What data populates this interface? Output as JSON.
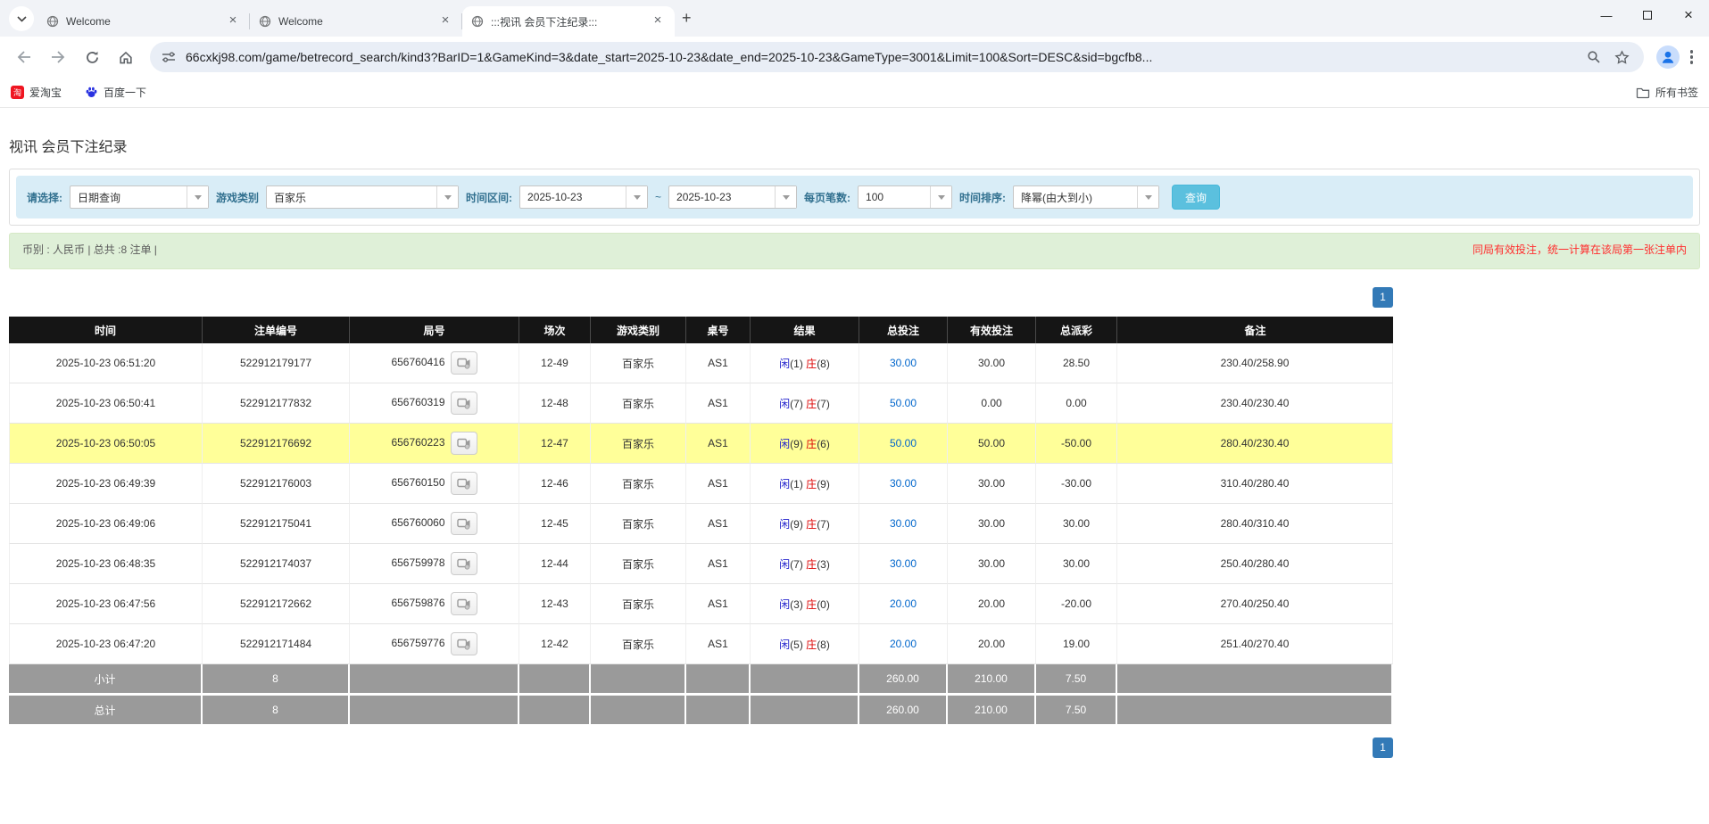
{
  "browser": {
    "tabs": [
      {
        "title": "Welcome"
      },
      {
        "title": "Welcome"
      },
      {
        "title": ":::视讯 会员下注纪录:::"
      }
    ],
    "url": "66cxkj98.com/game/betrecord_search/kind3?BarID=1&GameKind=3&date_start=2025-10-23&date_end=2025-10-23&GameType=3001&Limit=100&Sort=DESC&sid=bgcfb8...",
    "bookmarks": {
      "items": [
        {
          "label": "爱淘宝"
        },
        {
          "label": "百度一下"
        }
      ],
      "all_label": "所有书签"
    }
  },
  "page": {
    "title": "视讯 会员下注纪录",
    "filters": {
      "select_label": "请选择:",
      "select_value": "日期查询",
      "game_label": "游戏类别",
      "game_value": "百家乐",
      "range_label": "时间区间:",
      "date_start": "2025-10-23",
      "range_sep": "~",
      "date_end": "2025-10-23",
      "per_page_label": "每页笔数:",
      "per_page_value": "100",
      "sort_label": "时间排序:",
      "sort_value": "降幂(由大到小)",
      "search_button": "查询"
    },
    "summary": {
      "currency_info": "币别 : 人民币 | 总共 :8 注单 |",
      "note": "同局有效投注，统一计算在该局第一张注单内"
    },
    "pagination": {
      "page": "1"
    },
    "table": {
      "headers": [
        "时间",
        "注单编号",
        "局号",
        "场次",
        "游戏类别",
        "桌号",
        "结果",
        "总投注",
        "有效投注",
        "总派彩",
        "备注"
      ],
      "rows": [
        {
          "time": "2025-10-23 06:51:20",
          "bet_id": "522912179177",
          "round_id": "656760416",
          "session": "12-49",
          "game": "百家乐",
          "table": "AS1",
          "player": "闲",
          "player_n": "(1)",
          "banker": "庄",
          "banker_n": "(8)",
          "total_bet": "30.00",
          "valid_bet": "30.00",
          "payout": "28.50",
          "remark": "230.40/258.90",
          "highlighted": false
        },
        {
          "time": "2025-10-23 06:50:41",
          "bet_id": "522912177832",
          "round_id": "656760319",
          "session": "12-48",
          "game": "百家乐",
          "table": "AS1",
          "player": "闲",
          "player_n": "(7)",
          "banker": "庄",
          "banker_n": "(7)",
          "total_bet": "50.00",
          "valid_bet": "0.00",
          "payout": "0.00",
          "remark": "230.40/230.40",
          "highlighted": false
        },
        {
          "time": "2025-10-23 06:50:05",
          "bet_id": "522912176692",
          "round_id": "656760223",
          "session": "12-47",
          "game": "百家乐",
          "table": "AS1",
          "player": "闲",
          "player_n": "(9)",
          "banker": "庄",
          "banker_n": "(6)",
          "total_bet": "50.00",
          "valid_bet": "50.00",
          "payout": "-50.00",
          "remark": "280.40/230.40",
          "highlighted": true
        },
        {
          "time": "2025-10-23 06:49:39",
          "bet_id": "522912176003",
          "round_id": "656760150",
          "session": "12-46",
          "game": "百家乐",
          "table": "AS1",
          "player": "闲",
          "player_n": "(1)",
          "banker": "庄",
          "banker_n": "(9)",
          "total_bet": "30.00",
          "valid_bet": "30.00",
          "payout": "-30.00",
          "remark": "310.40/280.40",
          "highlighted": false
        },
        {
          "time": "2025-10-23 06:49:06",
          "bet_id": "522912175041",
          "round_id": "656760060",
          "session": "12-45",
          "game": "百家乐",
          "table": "AS1",
          "player": "闲",
          "player_n": "(9)",
          "banker": "庄",
          "banker_n": "(7)",
          "total_bet": "30.00",
          "valid_bet": "30.00",
          "payout": "30.00",
          "remark": "280.40/310.40",
          "highlighted": false
        },
        {
          "time": "2025-10-23 06:48:35",
          "bet_id": "522912174037",
          "round_id": "656759978",
          "session": "12-44",
          "game": "百家乐",
          "table": "AS1",
          "player": "闲",
          "player_n": "(7)",
          "banker": "庄",
          "banker_n": "(3)",
          "total_bet": "30.00",
          "valid_bet": "30.00",
          "payout": "30.00",
          "remark": "250.40/280.40",
          "highlighted": false
        },
        {
          "time": "2025-10-23 06:47:56",
          "bet_id": "522912172662",
          "round_id": "656759876",
          "session": "12-43",
          "game": "百家乐",
          "table": "AS1",
          "player": "闲",
          "player_n": "(3)",
          "banker": "庄",
          "banker_n": "(0)",
          "total_bet": "20.00",
          "valid_bet": "20.00",
          "payout": "-20.00",
          "remark": "270.40/250.40",
          "highlighted": false
        },
        {
          "time": "2025-10-23 06:47:20",
          "bet_id": "522912171484",
          "round_id": "656759776",
          "session": "12-42",
          "game": "百家乐",
          "table": "AS1",
          "player": "闲",
          "player_n": "(5)",
          "banker": "庄",
          "banker_n": "(8)",
          "total_bet": "20.00",
          "valid_bet": "20.00",
          "payout": "19.00",
          "remark": "251.40/270.40",
          "highlighted": false
        }
      ],
      "subtotal": {
        "label": "小计",
        "count": "8",
        "total_bet": "260.00",
        "valid_bet": "210.00",
        "payout": "7.50"
      },
      "total": {
        "label": "总计",
        "count": "8",
        "total_bet": "260.00",
        "valid_bet": "210.00",
        "payout": "7.50"
      }
    }
  },
  "colors": {
    "pagination_active": "#337ab7",
    "row_highlight": "#ffff99",
    "result_player_blue": "#2222cc",
    "result_banker_red": "#dd0000",
    "bet_amount_link": "#0066cc",
    "negative_value": "#e60000",
    "filter_bar_bg": "#d9edf7",
    "summary_bar_bg": "#dff0d8",
    "search_button_bg": "#5bc0de",
    "table_header_bg": "#151515",
    "table_footer_bg": "#9a9a9a"
  }
}
